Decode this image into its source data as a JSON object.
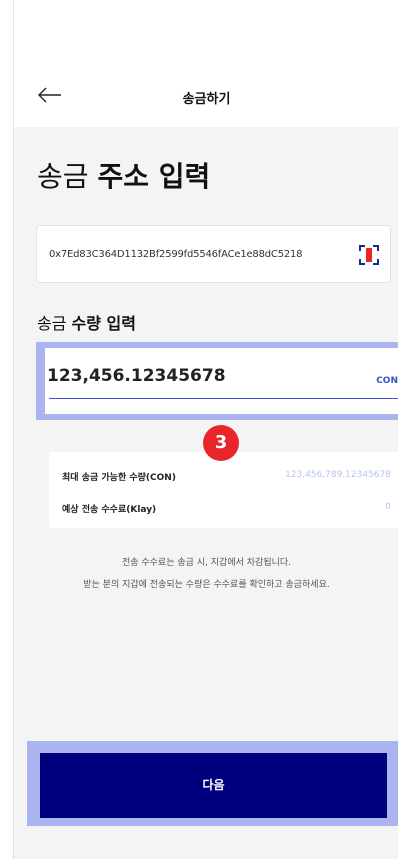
{
  "header": {
    "title": "송금하기",
    "back_icon": "arrow-left-icon"
  },
  "address_section": {
    "title_prefix": "송금",
    "title_bold": "주소 입력",
    "address_value": "0x7Ed83C364D1132Bf2599fd5546fACe1e88dC5218",
    "scan_icon": "qr-scan-icon",
    "scan_icon_color": "#e8252b"
  },
  "amount_section": {
    "title_prefix": "송금",
    "title_bold": "수량 입력",
    "amount_value": "123,456.12345678",
    "unit": "CON"
  },
  "step_badge": "3",
  "info": {
    "max_label": "최대 송금 가능한 수량(CON)",
    "max_value": "123,456,789.12345678",
    "fee_label": "예상 전송 수수료(Klay)",
    "fee_value": "0"
  },
  "notes": {
    "line1": "전송 수수료는 송금 시, 지갑에서 차감됩니다.",
    "line2": "받는 분의 지갑에 전송되는 수량은 수수료를 확인하고 송금하세요."
  },
  "next_button": {
    "label": "다음"
  },
  "colors": {
    "accent": "#00007f",
    "highlight": "#aab4ee",
    "badge": "#e8252b",
    "unit_text": "#3352c8"
  }
}
